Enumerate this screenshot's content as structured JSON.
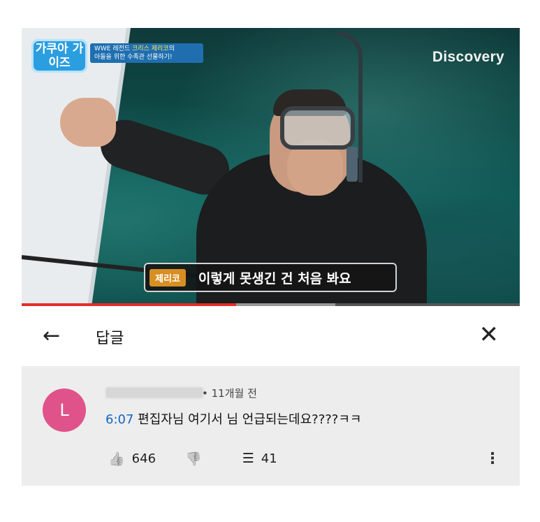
{
  "video": {
    "show_logo": "가쿠아 가이즈",
    "topic_line1_prefix": "WWE 레전드 ",
    "topic_line1_highlight": "크리스 제리코",
    "topic_line1_suffix": "의",
    "topic_line2": "아들을 위한 수족관 선물하기!",
    "channel_logo": "Discovery",
    "subtitle_speaker": "제리코",
    "subtitle_text": "이렇게 못생긴 건 처음 봐요",
    "progress_fraction": 0.43
  },
  "header": {
    "back_icon": "←",
    "title": "답글",
    "close_icon": "✕"
  },
  "comment": {
    "avatar_letter": "L",
    "avatar_color": "#e0538a",
    "time": "• 11개월 전",
    "timestamp_link": "6:07",
    "text": " 편집자님 여기서 님 언급되는데요????ㅋㅋ",
    "likes": "646",
    "replies": "41",
    "like_icon": "👍",
    "dislike_icon": "👎",
    "reply_icon": "☰",
    "more_icon": "⋮"
  }
}
